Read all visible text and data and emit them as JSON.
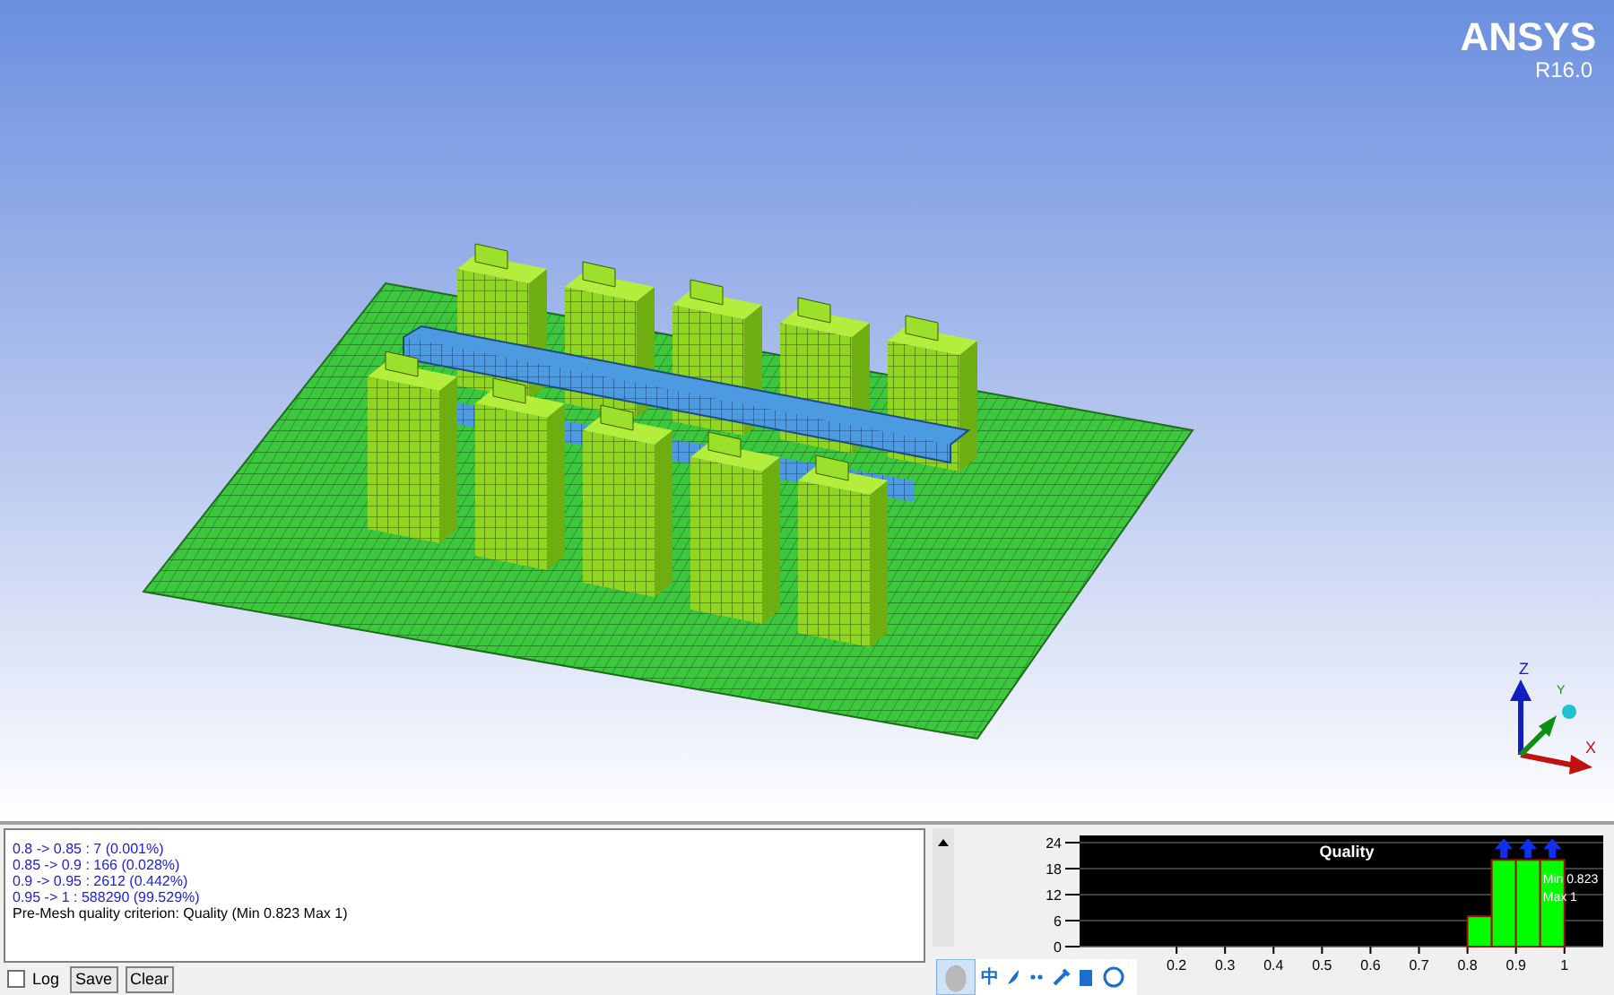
{
  "viewport": {
    "logo": "ANSYS",
    "version": "R16.0",
    "triad": {
      "z": "Z",
      "x": "X",
      "y": "Y"
    }
  },
  "log": {
    "lines": [
      {
        "kind": "range",
        "text": "0.8 -> 0.85 : 7 (0.001%)"
      },
      {
        "kind": "range",
        "text": "0.85 -> 0.9 : 166 (0.028%)"
      },
      {
        "kind": "range",
        "text": "0.9 -> 0.95 : 2612 (0.442%)"
      },
      {
        "kind": "range",
        "text": "0.95 -> 1 : 588290 (99.529%)"
      },
      {
        "kind": "info",
        "text": "Pre-Mesh quality criterion: Quality (Min 0.823 Max 1)"
      }
    ],
    "log_checkbox": {
      "label": "Log",
      "checked": false
    },
    "buttons": [
      "Save",
      "Clear"
    ]
  },
  "histogram": {
    "chart_data": {
      "type": "bar",
      "title": "Quality",
      "x": [
        0.825,
        0.875,
        0.925,
        0.975
      ],
      "values": [
        7,
        20,
        20,
        20
      ],
      "xlim": [
        0,
        1.08
      ],
      "grid": true,
      "ylim": [
        0,
        24
      ],
      "xticks": [
        0.2,
        0.3,
        0.4,
        0.5,
        0.6,
        0.7,
        0.8,
        0.9,
        1
      ],
      "yticks": [
        0,
        6,
        12,
        18,
        24
      ],
      "annotations": [
        "Min 0.823",
        "Max 1"
      ]
    }
  },
  "ime_toolbar": {
    "label": "中"
  }
}
